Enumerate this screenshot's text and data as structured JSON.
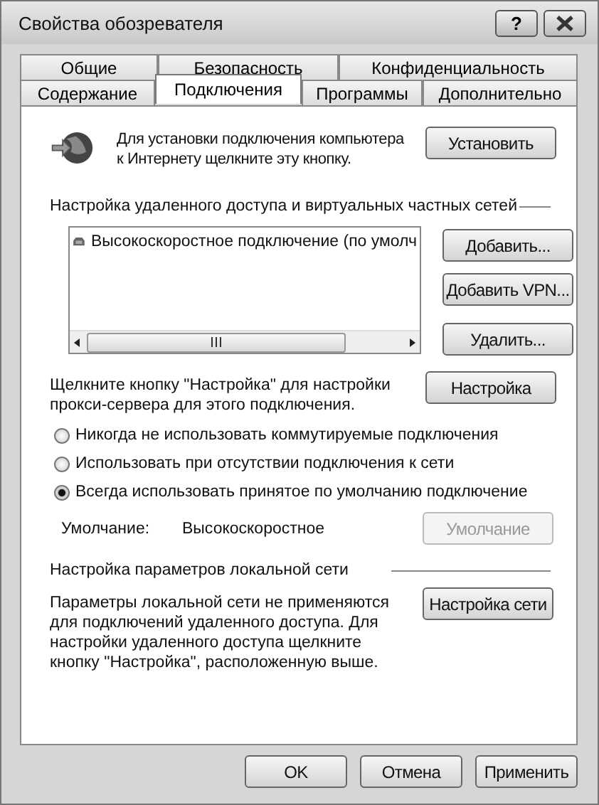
{
  "window": {
    "title": "Свойства обозревателя",
    "help_button": "?"
  },
  "tab_rows": [
    [
      {
        "label": "Общие",
        "selected": false
      },
      {
        "label": "Безопасность",
        "selected": false
      },
      {
        "label": "Конфиденциальность",
        "selected": false
      }
    ],
    [
      {
        "label": "Содержание",
        "selected": false
      },
      {
        "label": "Подключения",
        "selected": true
      },
      {
        "label": "Программы",
        "selected": false
      },
      {
        "label": "Дополнительно",
        "selected": false
      }
    ]
  ],
  "setup": {
    "text": "Для установки подключения компьютера к Интернету щелкните эту кнопку.",
    "button": "Установить"
  },
  "dialup": {
    "heading": "Настройка удаленного доступа и виртуальных частных сетей",
    "connections": [
      "Высокоскоростное подключение (по умолч"
    ],
    "buttons": [
      "Добавить...",
      "Добавить VPN...",
      "Удалить..."
    ]
  },
  "proxy": {
    "text": "Щелкните кнопку \"Настройка\" для настройки прокси-сервера для этого подключения.",
    "button": "Настройка"
  },
  "radios": [
    {
      "label": "Никогда не использовать коммутируемые подключения",
      "selected": false
    },
    {
      "label": "Использовать при отсутствии подключения к сети",
      "selected": false
    },
    {
      "label": "Всегда использовать принятое по умолчанию подключение",
      "selected": true
    }
  ],
  "default": {
    "label": "Умолчание:",
    "value": "Высокоскоростное",
    "button": "Умолчание",
    "disabled": true
  },
  "lan": {
    "heading": "Настройка параметров локальной сети",
    "text": "Параметры локальной сети не применяются для подключений удаленного доступа. Для настройки удаленного доступа щелкните кнопку \"Настройка\", расположенную выше.",
    "button": "Настройка сети"
  },
  "buttons": [
    "OK",
    "Отмена",
    "Применить"
  ]
}
